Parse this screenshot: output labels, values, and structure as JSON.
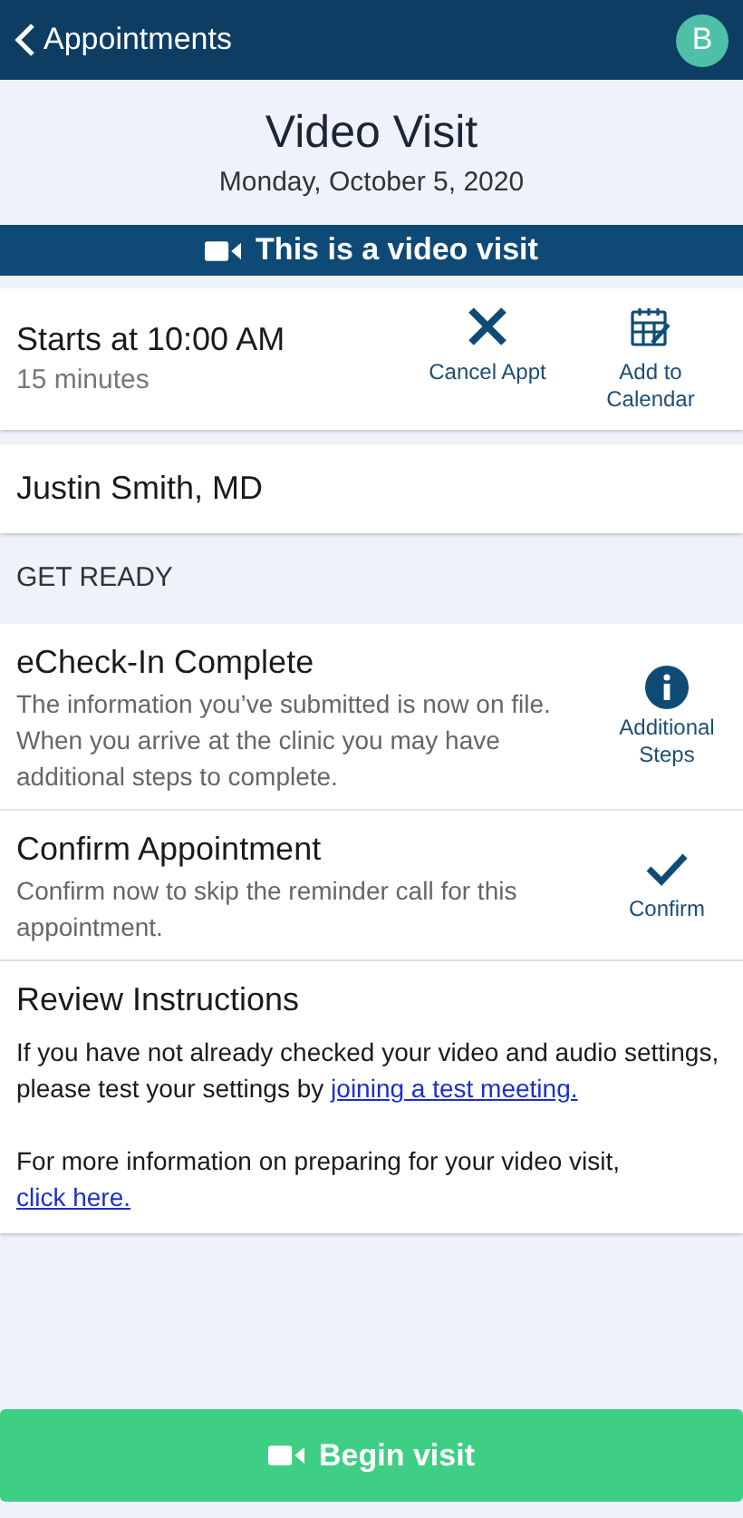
{
  "header": {
    "back_label": "Appointments",
    "avatar": "B"
  },
  "title": "Video Visit",
  "date": "Monday, October 5, 2020",
  "banner": "This is a video visit",
  "time_card": {
    "start": "Starts at 10:00 AM",
    "duration": "15 minutes",
    "actions": [
      {
        "kind": "cancel",
        "label": "Cancel Appt"
      },
      {
        "kind": "calendar",
        "label": "Add to Calendar"
      }
    ]
  },
  "provider": "Justin Smith, MD",
  "section_title": "GET READY",
  "steps": [
    {
      "kind": "info",
      "title": "eCheck-In Complete",
      "text": "The information you’ve submitted is now on file. When you arrive at the clinic you may have additional steps to complete.",
      "action": "Additional Steps"
    },
    {
      "kind": "confirm",
      "title": "Confirm Appointment",
      "text": "Confirm now to skip the reminder call for this appointment.",
      "action": "Confirm"
    }
  ],
  "instructions": {
    "title": "Review Instructions",
    "paragraphs": [
      {
        "text": "If you have not already checked your video and audio settings, please test your settings by",
        "link": "joining a test meeting."
      },
      {
        "text": "For more information on preparing for your video visit,",
        "link": "click here."
      }
    ]
  },
  "begin_button": "Begin visit"
}
